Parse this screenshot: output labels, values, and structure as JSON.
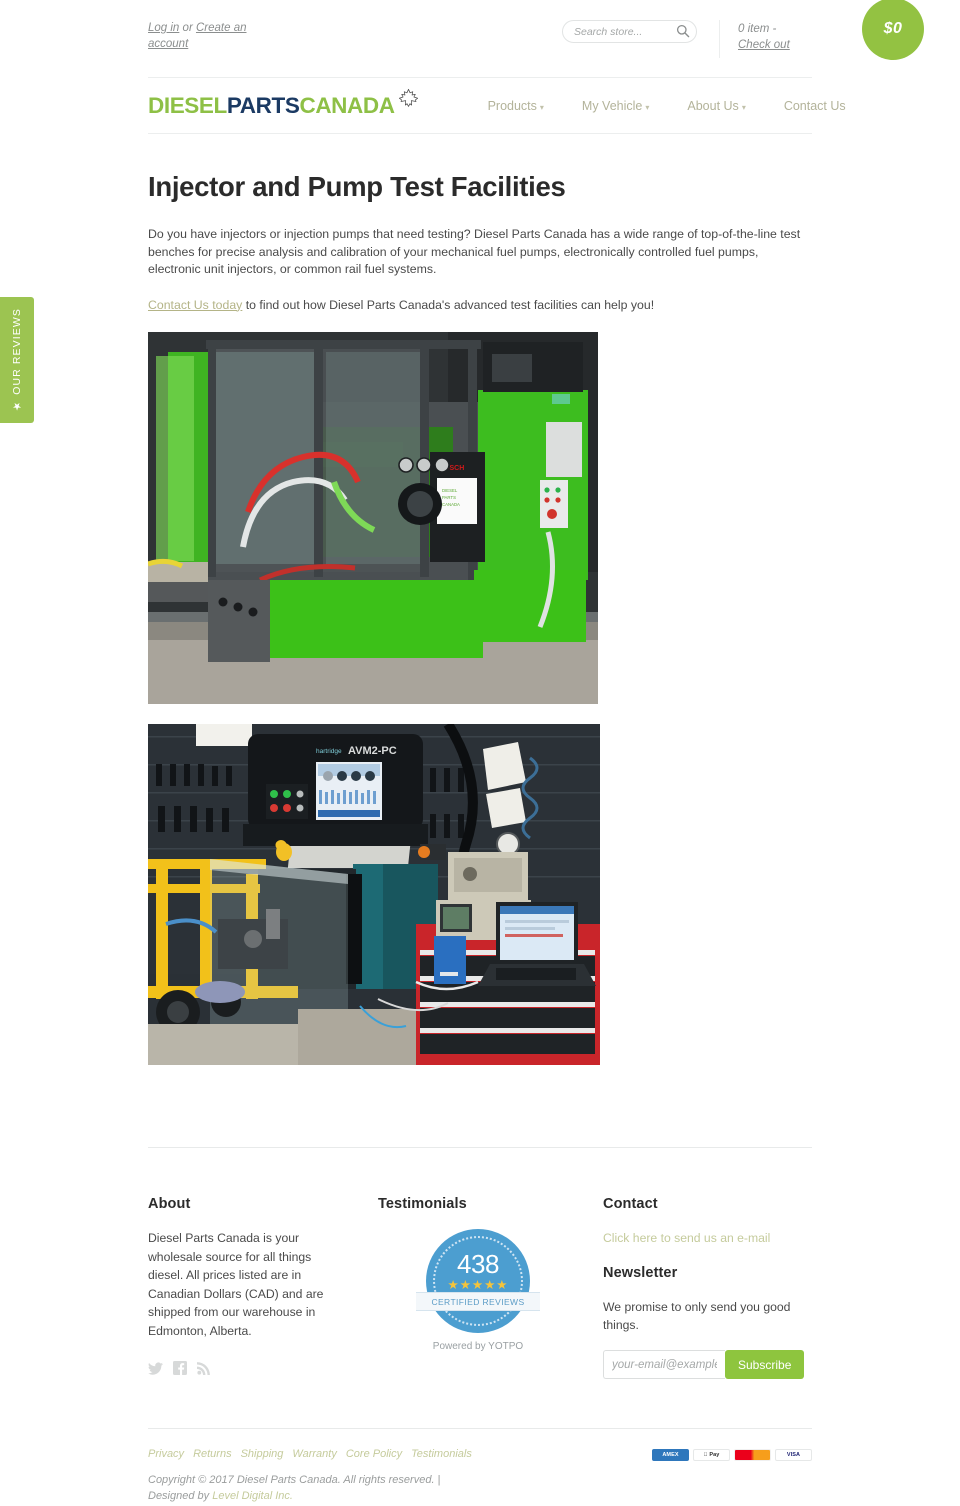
{
  "topbar": {
    "login_label": "Log in",
    "or_label": "or",
    "create_account_label": "Create an account",
    "search_placeholder": "Search store...",
    "cart_items": "0 item",
    "cart_separator": "-",
    "checkout_label": "Check out",
    "cart_total": "$0"
  },
  "logo": {
    "part1": "DIESEL",
    "part2": "PARTS",
    "part3": "CANADA",
    "colors": {
      "green": "#8ec046",
      "navy": "#1b3a63"
    }
  },
  "nav": {
    "items": [
      {
        "label": "Products",
        "has_dropdown": true
      },
      {
        "label": "My Vehicle",
        "has_dropdown": true
      },
      {
        "label": "About Us",
        "has_dropdown": true
      },
      {
        "label": "Contact Us",
        "has_dropdown": false
      }
    ],
    "caret_glyph": "▾"
  },
  "reviews_tab": {
    "label": "★ OUR REVIEWS",
    "color": "#9cc451"
  },
  "main": {
    "title": "Injector and Pump Test Facilities",
    "paragraph1": "Do you have injectors or injection pumps that need testing?  Diesel Parts Canada has a wide range of top-of-the-line test benches for precise analysis and calibration of your mechanical fuel pumps, electronically controlled fuel pumps, electronic unit injectors, or common rail fuel systems.",
    "cta_link": "Contact Us today",
    "paragraph2_rest": " to find out how Diesel Parts Canada's advanced test facilities can help you!",
    "images": [
      {
        "alt": "Green Bosch common rail injector test bench with clear safety enclosure in a workshop"
      },
      {
        "alt": "AVM2-PC pump test bench with yellow mounting fixture, oscilloscope, and laptop on a red tool chest"
      }
    ]
  },
  "footer": {
    "about": {
      "heading": "About",
      "text": "Diesel Parts Canada is your wholesale source for all things diesel. All prices listed are in Canadian Dollars (CAD) and are shipped from our warehouse in Edmonton, Alberta.",
      "social": [
        "twitter-icon",
        "facebook-icon",
        "rss-icon"
      ]
    },
    "testimonials": {
      "heading": "Testimonials",
      "badge_count": "438",
      "badge_stars": "★★★★★",
      "badge_ribbon": "CERTIFIED REVIEWS",
      "badge_powered": "Powered by YOTPO",
      "badge_color": "#4c9ed0",
      "star_color": "#f5c43b"
    },
    "contact": {
      "heading": "Contact",
      "email_link": "Click here to send us an e-mail",
      "newsletter_heading": "Newsletter",
      "newsletter_text": "We promise to only send you good things.",
      "email_placeholder": "your-email@example.com",
      "subscribe_label": "Subscribe",
      "subscribe_color": "#8ec53e"
    }
  },
  "bottom": {
    "policy_links": [
      "Privacy",
      "Returns",
      "Shipping",
      "Warranty",
      "Core Policy",
      "Testimonials"
    ],
    "copyright": "Copyright © 2017 Diesel Parts Canada. All rights reserved. | Designed by ",
    "designer": "Level Digital Inc.",
    "payments": [
      "AMEX",
      " Pay",
      "",
      "VISA"
    ]
  }
}
